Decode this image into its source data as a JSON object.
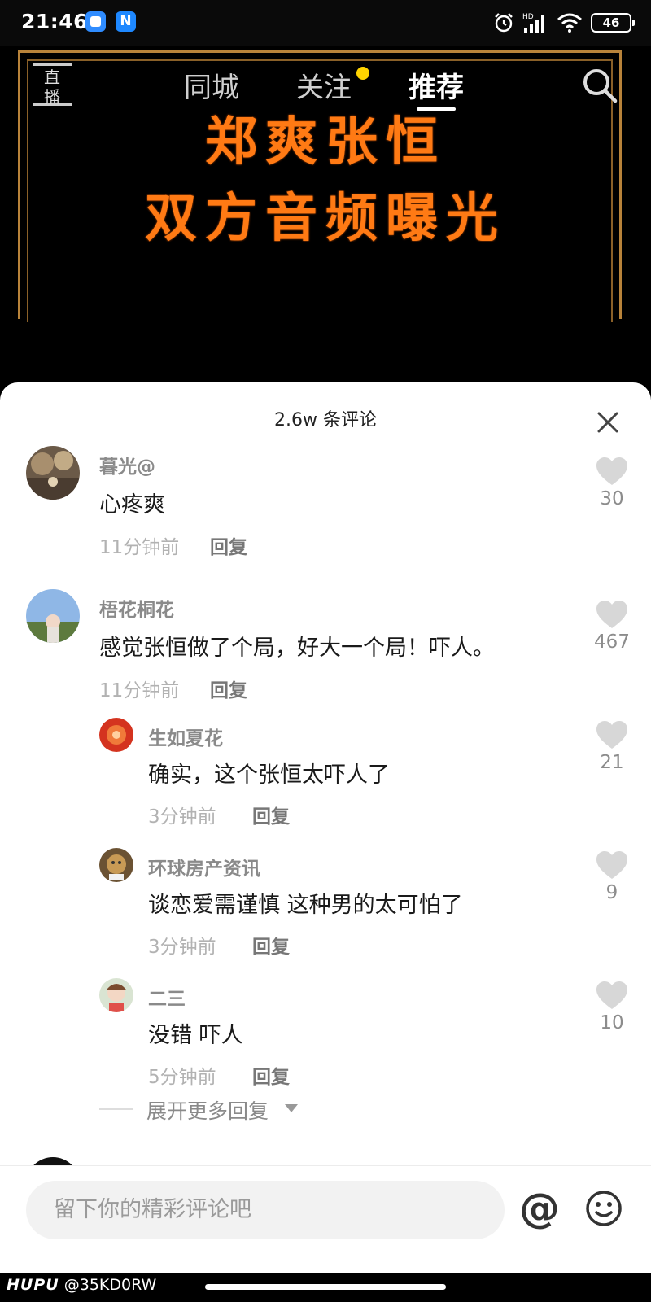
{
  "status_bar": {
    "time": "21:46",
    "app_icon_label": "N",
    "battery": "46",
    "hd_label": "HD"
  },
  "video": {
    "title_line1": "郑爽张恒",
    "title_line2": "双方音频曝光"
  },
  "top_nav": {
    "live_label_line1": "直",
    "live_label_line2": "播",
    "tabs": [
      {
        "label": "同城"
      },
      {
        "label": "关注"
      },
      {
        "label": "推荐"
      }
    ]
  },
  "comments_sheet": {
    "title": "2.6w 条评论",
    "comments": [
      {
        "name": "暮光@",
        "text": "心疼爽",
        "time": "11分钟前",
        "reply_label": "回复",
        "likes": "30"
      },
      {
        "name": "梧花桐花",
        "text": "感觉张恒做了个局，好大一个局！吓人。",
        "time": "11分钟前",
        "reply_label": "回复",
        "likes": "467"
      }
    ],
    "replies": [
      {
        "name": "生如夏花",
        "text": "确实，这个张恒太吓人了",
        "time": "3分钟前",
        "reply_label": "回复",
        "likes": "21"
      },
      {
        "name": "环球房产资讯",
        "text": "谈恋爱需谨慎 这种男的太可怕了",
        "time": "3分钟前",
        "reply_label": "回复",
        "likes": "9"
      },
      {
        "name": "二三",
        "text": "没错 吓人",
        "time": "5分钟前",
        "reply_label": "回复",
        "likes": "10"
      }
    ],
    "expand_label": "展开更多回复",
    "input_placeholder": "留下你的精彩评论吧",
    "at_symbol": "@"
  },
  "watermark": {
    "brand": "HUPU",
    "handle": "@35KD0RW"
  },
  "colors": {
    "title_orange": "#ff7a14",
    "frame_gold": "#b8833a",
    "notify_dot": "#ffd400"
  }
}
